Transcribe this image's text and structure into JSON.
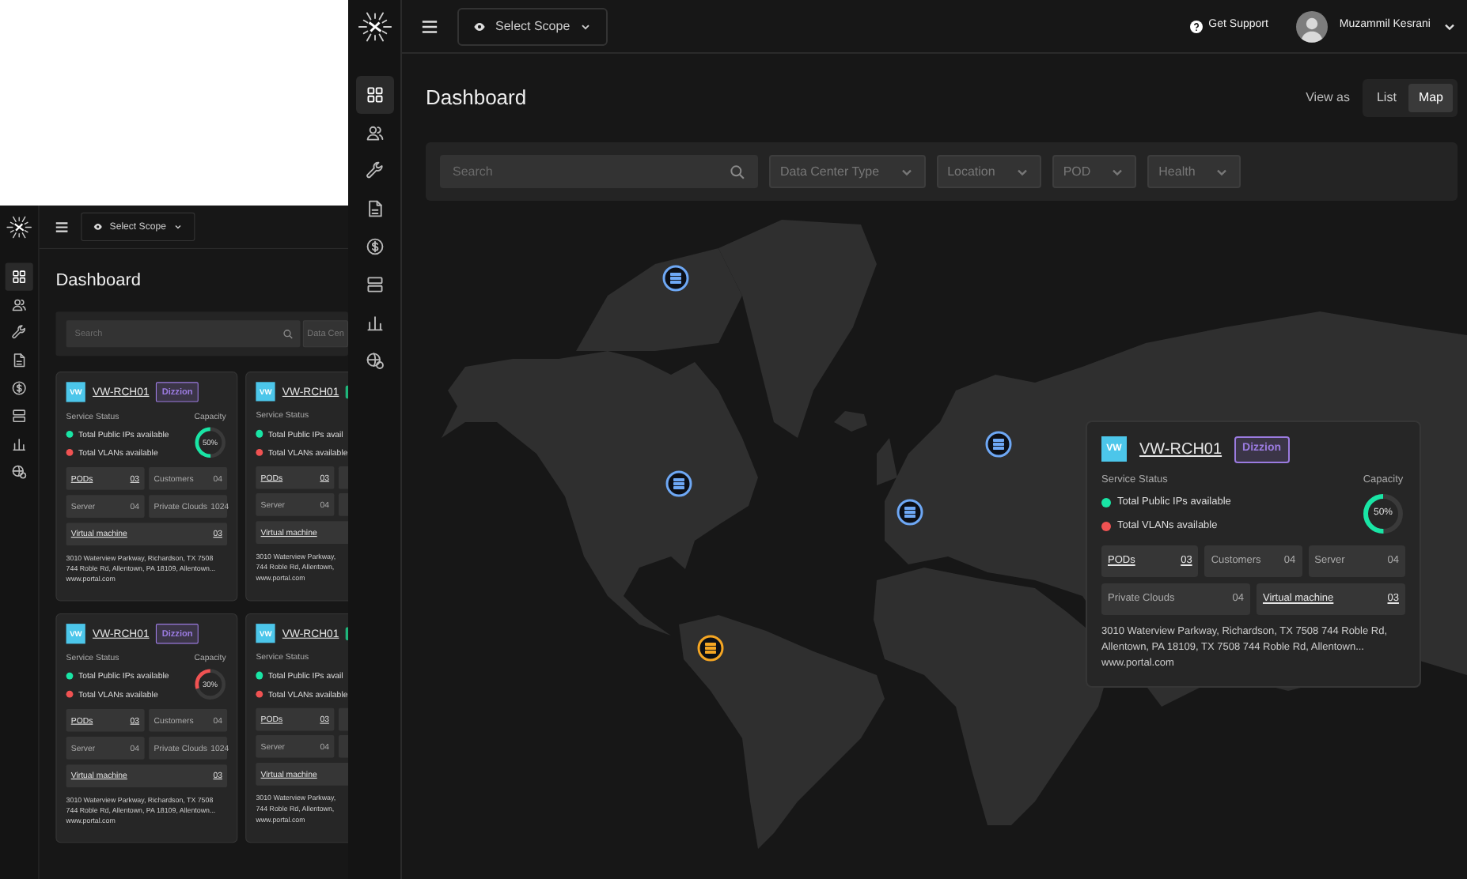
{
  "background_window": {
    "scope_button": "Select Scope",
    "sidebar_items": [
      {
        "selected": true
      },
      {
        "selected": false
      },
      {
        "selected": false
      },
      {
        "selected": false
      },
      {
        "selected": false
      },
      {
        "selected": false
      },
      {
        "selected": false
      },
      {
        "selected": false
      }
    ],
    "title": "Dashboard",
    "search": {
      "placeholder": "Search"
    },
    "filters": [
      "Data Cen"
    ],
    "cards": [
      {
        "logo": "VW",
        "name": "VW-RCH01",
        "badge": {
          "text": "Dizzion",
          "color": "#9b7be0"
        },
        "status_label": "Service Status",
        "statuses": [
          {
            "text": "Total Public IPs available",
            "color": "#19e5a5"
          },
          {
            "text": "Total VLANs available",
            "color": "#f05252"
          }
        ],
        "capacity_label": "Capacity",
        "capacity": {
          "level": 0.5,
          "reading": "50%",
          "color": "#19e5a5"
        },
        "stats": [
          {
            "label": "PODs",
            "value": "03",
            "linked": true,
            "kind": "half"
          },
          {
            "label": "Customers",
            "value": "04",
            "linked": false,
            "kind": "half"
          },
          {
            "label": "Server",
            "value": "04",
            "linked": false,
            "kind": "half"
          },
          {
            "label": "Private Clouds",
            "value": "1024",
            "linked": false,
            "kind": "half"
          },
          {
            "label": "Virtual machine",
            "value": "03",
            "linked": true,
            "kind": "full"
          }
        ],
        "address": [
          "3010 Waterview Parkway, Richardson, TX 7508",
          "744 Roble Rd, Allentown, PA 18109, Allentown..."
        ],
        "website": "www.portal.com"
      },
      {
        "logo": "VW",
        "name": "VW-RCH01",
        "badge": {
          "color": "#1fb57a"
        },
        "status_label": "Service Status",
        "statuses": [
          {
            "text": "Total Public IPs avail",
            "color": "#19e5a5"
          },
          {
            "text": "Total VLANs available",
            "color": "#f05252"
          }
        ],
        "stats": [
          {
            "label": "PODs",
            "value": "03",
            "linked": true,
            "kind": "half"
          },
          {
            "kind": "half"
          },
          {
            "label": "Server",
            "value": "04",
            "linked": false,
            "kind": "half"
          },
          {
            "kind": "half"
          },
          {
            "label": "Virtual machine",
            "linked": true,
            "kind": "full"
          }
        ],
        "address": [
          "3010 Waterview Parkway,",
          "744 Roble Rd, Allentown,"
        ],
        "website": "www.portal.com"
      },
      {
        "logo": "VW",
        "name": "VW-RCH01",
        "badge": {
          "text": "Dizzion",
          "color": "#9b7be0"
        },
        "status_label": "Service Status",
        "statuses": [
          {
            "text": "Total Public IPs available",
            "color": "#19e5a5"
          },
          {
            "text": "Total VLANs available",
            "color": "#f05252"
          }
        ],
        "capacity_label": "Capacity",
        "capacity": {
          "level": 0.3,
          "reading": "30%",
          "color": "#f05252"
        },
        "stats": [
          {
            "label": "PODs",
            "value": "03",
            "linked": true,
            "kind": "half"
          },
          {
            "label": "Customers",
            "value": "04",
            "linked": false,
            "kind": "half"
          },
          {
            "label": "Server",
            "value": "04",
            "linked": false,
            "kind": "half"
          },
          {
            "label": "Private Clouds",
            "value": "1024",
            "linked": false,
            "kind": "half"
          },
          {
            "label": "Virtual machine",
            "value": "03",
            "linked": true,
            "kind": "full"
          }
        ],
        "address": [
          "3010 Waterview Parkway, Richardson, TX 7508",
          "744 Roble Rd, Allentown, PA 18109, Allentown..."
        ],
        "website": "www.portal.com"
      },
      {
        "logo": "VW",
        "name": "VW-RCH01",
        "badge": {
          "color": "#1fb57a"
        },
        "status_label": "Service Status",
        "statuses": [
          {
            "text": "Total Public IPs avail",
            "color": "#19e5a5"
          },
          {
            "text": "Total VLANs available",
            "color": "#f05252"
          }
        ],
        "stats": [
          {
            "label": "PODs",
            "value": "03",
            "linked": true,
            "kind": "half"
          },
          {
            "kind": "half"
          },
          {
            "label": "Server",
            "value": "04",
            "linked": false,
            "kind": "half"
          },
          {
            "kind": "half"
          },
          {
            "label": "Virtual machine",
            "linked": true,
            "kind": "full"
          }
        ],
        "address": [
          "3010 Waterview Parkway,",
          "744 Roble Rd, Allentown,"
        ],
        "website": "www.portal.com"
      }
    ]
  },
  "header": {
    "scope_button": "Select Scope",
    "support": "Get Support",
    "user_name": "Muzammil Kesrani"
  },
  "sidebar_items": [
    {
      "selected": true
    },
    {
      "selected": false
    },
    {
      "selected": false
    },
    {
      "selected": false
    },
    {
      "selected": false
    },
    {
      "selected": false
    },
    {
      "selected": false
    },
    {
      "selected": false
    }
  ],
  "title": "Dashboard",
  "view_toggle": {
    "label": "View as",
    "options": [
      {
        "label": "List",
        "selected": false
      },
      {
        "label": "Map",
        "selected": true
      }
    ]
  },
  "search": {
    "placeholder": "Search"
  },
  "filters": [
    "Data Center Type",
    "Location",
    "POD",
    "Health"
  ],
  "map": {
    "markers": [
      {
        "color": "#6ea8f5"
      },
      {
        "color": "#6ea8f5"
      },
      {
        "color": "#6ea8f5"
      },
      {
        "color": "#6ea8f5"
      },
      {
        "color": "#f5a623"
      }
    ]
  },
  "popup_card": {
    "logo": "VW",
    "name": "VW-RCH01",
    "badge": {
      "text": "Dizzion",
      "color": "#9b7be0"
    },
    "status_label": "Service Status",
    "statuses": [
      {
        "text": "Total Public IPs available",
        "color": "#19e5a5"
      },
      {
        "text": "Total VLANs available",
        "color": "#f05252"
      }
    ],
    "capacity_label": "Capacity",
    "capacity": {
      "level": 0.5,
      "reading": "50%",
      "color": "#19e5a5"
    },
    "stats": [
      {
        "label": "PODs",
        "value": "03",
        "linked": true,
        "kind": "third"
      },
      {
        "label": "Customers",
        "value": "04",
        "linked": false,
        "kind": "third"
      },
      {
        "label": "Server",
        "value": "04",
        "linked": false,
        "kind": "third"
      },
      {
        "label": "Private Clouds",
        "value": "04",
        "linked": false,
        "kind": "half"
      },
      {
        "label": "Virtual machine",
        "value": "03",
        "linked": true,
        "kind": "half"
      }
    ],
    "address": [
      "3010 Waterview Parkway, Richardson, TX 7508 744 Roble Rd,",
      "Allentown, PA 18109, TX 7508 744 Roble Rd, Allentown..."
    ],
    "website": "www.portal.com"
  }
}
